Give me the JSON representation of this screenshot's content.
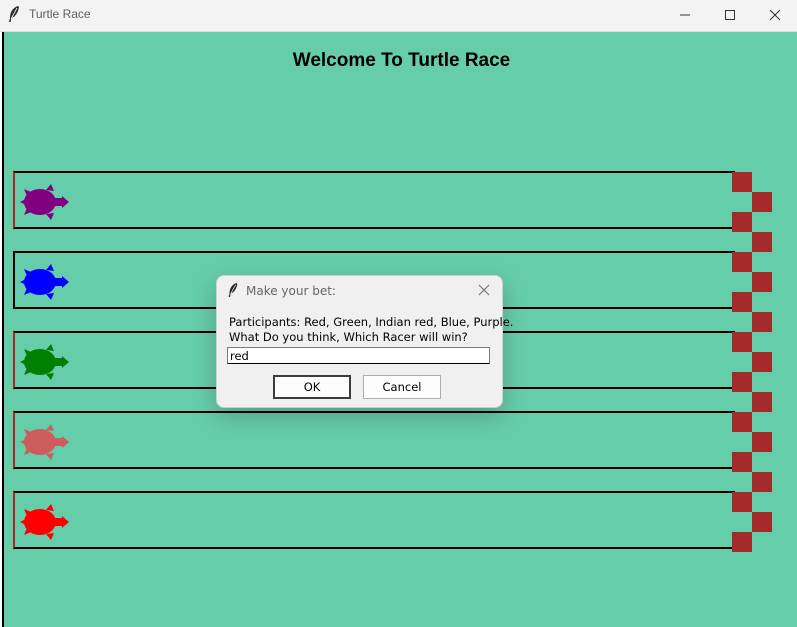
{
  "window": {
    "title": "Turtle Race",
    "icon": "feather-icon",
    "controls": [
      "minimize-icon",
      "maximize-icon",
      "close-icon"
    ]
  },
  "canvas": {
    "background": "#66cdaa",
    "heading": "Welcome To Turtle Race",
    "finish_color": "#a52a2a",
    "turtles": [
      {
        "name": "purple",
        "color": "#800080"
      },
      {
        "name": "blue",
        "color": "#0000ff"
      },
      {
        "name": "green",
        "color": "#008000"
      },
      {
        "name": "indian red",
        "color": "#cd5c5c"
      },
      {
        "name": "red",
        "color": "#ff0000"
      }
    ]
  },
  "dialog": {
    "title": "Make your bet:",
    "icon": "feather-icon",
    "prompt_line1": "Participants: Red, Green, Indian red, Blue, Purple.",
    "prompt_line2": "What Do you think, Which Racer will win?",
    "input_value": "red",
    "ok_label": "OK",
    "cancel_label": "Cancel"
  }
}
